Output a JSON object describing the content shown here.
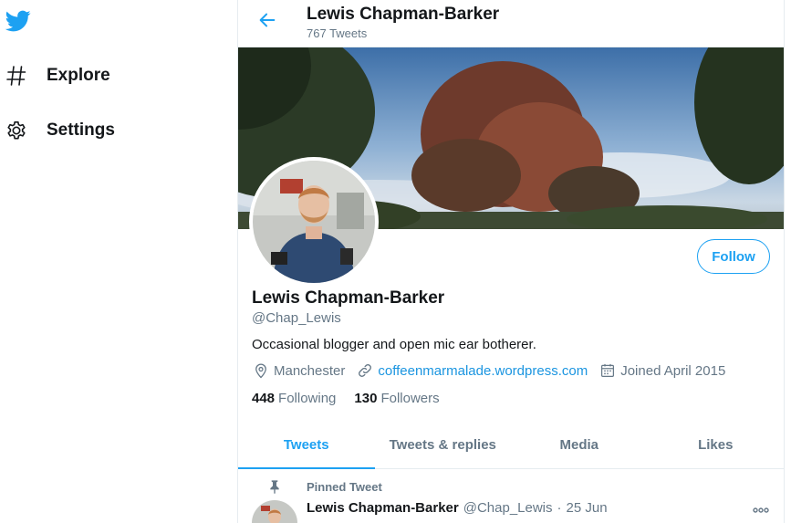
{
  "colors": {
    "accent": "#1da1f2",
    "link": "#1b95e0",
    "muted": "#657786",
    "text": "#14171a",
    "border": "#e6ecf0"
  },
  "sidebar": {
    "logo_icon": "twitter-bird-icon",
    "items": [
      {
        "label": "Explore",
        "icon": "hashtag-icon"
      },
      {
        "label": "Settings",
        "icon": "gear-icon"
      }
    ]
  },
  "header": {
    "back_icon": "arrow-left-icon",
    "title": "Lewis Chapman-Barker",
    "tweet_count": "767 Tweets"
  },
  "profile": {
    "name": "Lewis Chapman-Barker",
    "handle": "@Chap_Lewis",
    "bio": "Occasional blogger and open mic ear botherer.",
    "follow_label": "Follow",
    "location": "Manchester",
    "website": "coffeenmarmalade.wordpress.com",
    "joined": "Joined April 2015",
    "following_count": "448",
    "following_label": "Following",
    "followers_count": "130",
    "followers_label": "Followers"
  },
  "tabs": [
    {
      "label": "Tweets",
      "active": true
    },
    {
      "label": "Tweets & replies",
      "active": false
    },
    {
      "label": "Media",
      "active": false
    },
    {
      "label": "Likes",
      "active": false
    }
  ],
  "pinned_tweet": {
    "pinned_label": "Pinned Tweet",
    "author": "Lewis Chapman-Barker",
    "handle": "@Chap_Lewis",
    "separator": "·",
    "date": "25 Jun"
  }
}
